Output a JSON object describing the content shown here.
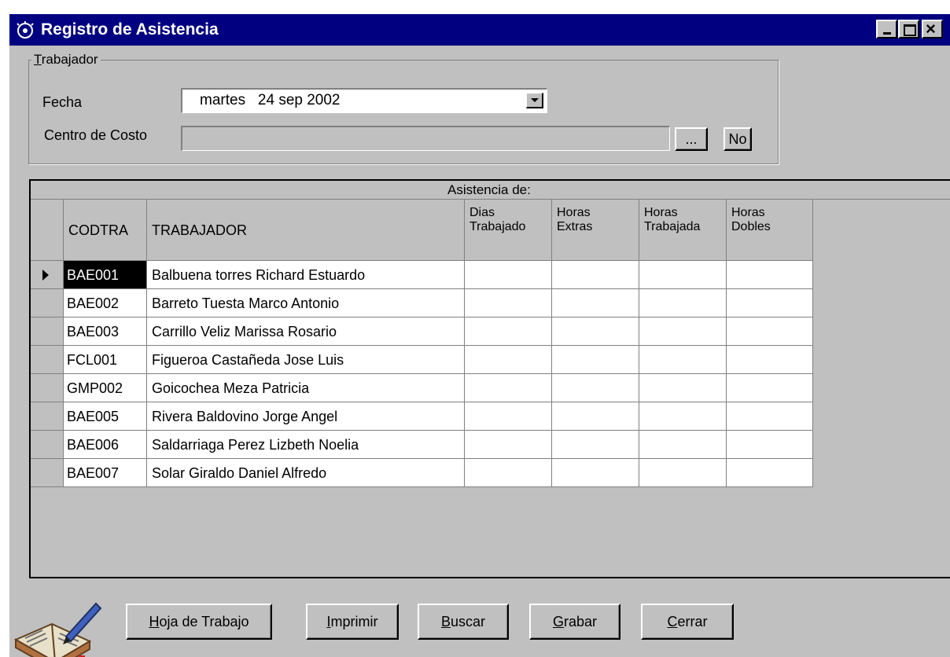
{
  "window": {
    "title": "Registro de Asistencia",
    "icon": "app-icon",
    "controls": [
      "minimize-icon",
      "maximize-icon",
      "close-icon"
    ],
    "close_glyph": "×"
  },
  "trabajador_group": {
    "label_underlined": "T",
    "label_rest": "rabajador",
    "fecha_label": "Fecha",
    "fecha_value": "martes   24 sep 2002",
    "centro_costo_label": "Centro de Costo",
    "centro_costo_value": "",
    "browse_label": "...",
    "no_label": "No"
  },
  "grid": {
    "group_header": "Asistencia de:",
    "columns": {
      "codtra": "CODTRA",
      "trabajador": "TRABAJADOR",
      "dias_1": "Dias",
      "dias_2": "Trabajado",
      "extras_1": "Horas",
      "extras_2": "Extras",
      "trabajadas_1": "Horas",
      "trabajadas_2": "Trabajada",
      "dobles_1": "Horas",
      "dobles_2": "Dobles"
    },
    "rows": [
      {
        "code": "BAE001",
        "name": "Balbuena torres Richard Estuardo",
        "dias": "",
        "extras": "",
        "trabajadas": "",
        "dobles": ""
      },
      {
        "code": "BAE002",
        "name": "Barreto Tuesta Marco Antonio",
        "dias": "",
        "extras": "",
        "trabajadas": "",
        "dobles": ""
      },
      {
        "code": "BAE003",
        "name": "Carrillo Veliz Marissa Rosario",
        "dias": "",
        "extras": "",
        "trabajadas": "",
        "dobles": ""
      },
      {
        "code": "FCL001",
        "name": "Figueroa Castañeda Jose Luis",
        "dias": "",
        "extras": "",
        "trabajadas": "",
        "dobles": ""
      },
      {
        "code": "GMP002",
        "name": "Goicochea Meza Patricia",
        "dias": "",
        "extras": "",
        "trabajadas": "",
        "dobles": ""
      },
      {
        "code": "BAE005",
        "name": "Rivera Baldovino Jorge Angel",
        "dias": "",
        "extras": "",
        "trabajadas": "",
        "dobles": ""
      },
      {
        "code": "BAE006",
        "name": "Saldarriaga Perez Lizbeth Noelia",
        "dias": "",
        "extras": "",
        "trabajadas": "",
        "dobles": ""
      },
      {
        "code": "BAE007",
        "name": "Solar Giraldo Daniel Alfredo",
        "dias": "",
        "extras": "",
        "trabajadas": "",
        "dobles": ""
      }
    ]
  },
  "buttons": {
    "hoja_u": "H",
    "hoja_rest": "oja de Trabajo",
    "imprimir_u": "I",
    "imprimir_rest": "mprimir",
    "buscar_u": "B",
    "buscar_rest": "uscar",
    "grabar_u": "G",
    "grabar_rest": "rabar",
    "cerrar_u": "C",
    "cerrar_rest": "errar"
  },
  "decor": {
    "book_icon": "book-with-pen-icon"
  },
  "colors": {
    "titlebar": "#000080",
    "face": "#c0c0c0",
    "selected_cell": "#000000"
  }
}
